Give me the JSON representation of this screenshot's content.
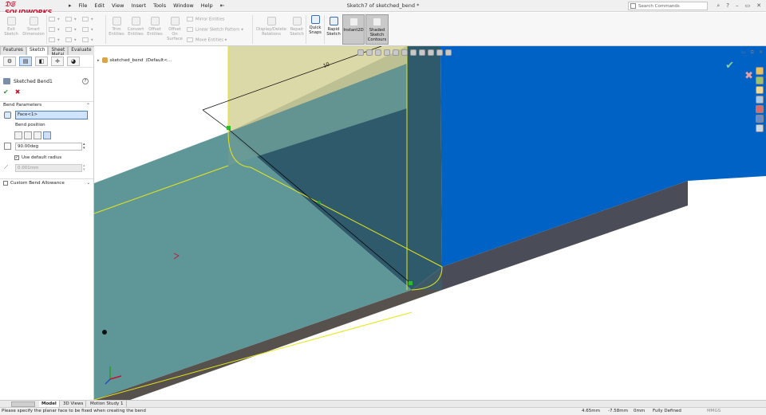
{
  "app": {
    "brand": "SOLIDWORKS",
    "doc_title": "Sketch7 of sketched_bend *"
  },
  "menu": {
    "items": [
      "File",
      "Edit",
      "View",
      "Insert",
      "Tools",
      "Window",
      "Help"
    ]
  },
  "search": {
    "placeholder": "Search Commands"
  },
  "ribbon": {
    "exit_sketch": "Exit Sketch",
    "smart_dimension": "Smart Dimension",
    "trim_entities": "Trim Entities",
    "convert_entities": "Convert Entities",
    "offset_entities": "Offset Entities",
    "offset_on_surface": "Offset On Surface",
    "mirror_entities": "Mirror Entities",
    "linear_sketch_pattern": "Linear Sketch Pattern",
    "move_entities": "Move Entities",
    "display_delete_relations": "Display/Delete Relations",
    "repair_sketch": "Repair Sketch",
    "quick_snaps": "Quick Snaps",
    "rapid_sketch": "Rapid Sketch",
    "instant2d": "Instant2D",
    "shaded_sketch_contours": "Shaded Sketch Contours"
  },
  "cm_tabs": [
    "Features",
    "Sketch",
    "Sheet Metal",
    "Evaluate"
  ],
  "property_manager": {
    "title": "Sketched Bend1",
    "group_title": "Bend Parameters",
    "face_value": "Face<1>",
    "bend_position_label": "Bend position",
    "angle_value": "90.00deg",
    "use_default_radius": "Use default radius",
    "radius_value": "0.001mm",
    "custom_bend_allowance": "Custom Bend Allowance"
  },
  "tree": {
    "root": "sketched_bend",
    "config": "(Default<..."
  },
  "dimension": {
    "value": "10"
  },
  "bottom_tabs": [
    "Model",
    "3D Views",
    "Motion Study 1"
  ],
  "status": {
    "message": "Please specify the planar face to be fixed when creating the bend",
    "x": "4.65mm",
    "y": "-7.58mm",
    "z": "0mm",
    "state": "Fully Defined",
    "units": "MMGS"
  },
  "colors": {
    "top_face": "#5f9799",
    "side_face": "#56514d",
    "blue_face": "#0062c4",
    "blue_side": "#4a4d57",
    "sketch_line": "#e6e619",
    "accent_red": "#c8102e"
  }
}
